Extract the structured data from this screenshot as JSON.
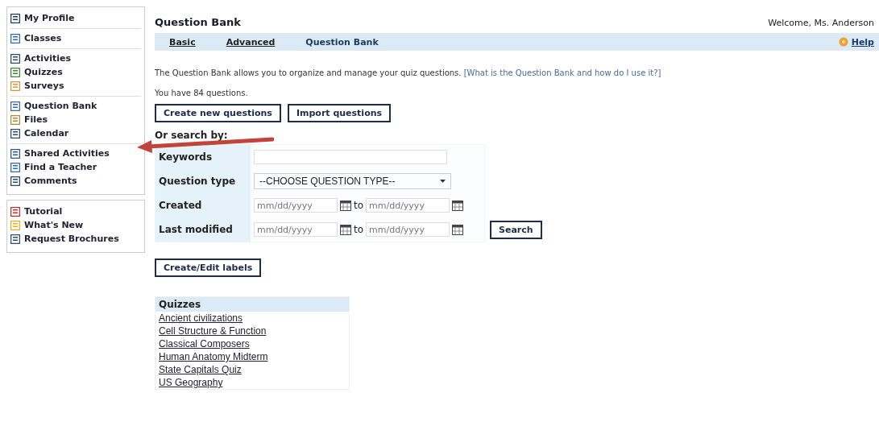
{
  "sidebar": {
    "groups": [
      {
        "sections": [
          {
            "items": [
              {
                "label": "My Profile"
              }
            ]
          },
          {
            "items": [
              {
                "label": "Classes"
              }
            ]
          },
          {
            "items": [
              {
                "label": "Activities"
              },
              {
                "label": "Quizzes"
              },
              {
                "label": "Surveys"
              }
            ]
          },
          {
            "items": [
              {
                "label": "Question Bank"
              },
              {
                "label": "Files"
              },
              {
                "label": "Calendar"
              }
            ]
          },
          {
            "items": [
              {
                "label": "Shared Activities"
              },
              {
                "label": "Find a Teacher"
              },
              {
                "label": "Comments"
              }
            ]
          }
        ]
      },
      {
        "sections": [
          {
            "items": [
              {
                "label": "Tutorial"
              },
              {
                "label": "What's New"
              },
              {
                "label": "Request Brochures"
              }
            ]
          }
        ]
      }
    ]
  },
  "header": {
    "title": "Question Bank",
    "welcome": "Welcome, Ms. Anderson"
  },
  "tabs": [
    {
      "label": "Basic",
      "selected": false
    },
    {
      "label": "Advanced",
      "selected": false
    },
    {
      "label": "Question Bank",
      "selected": true
    }
  ],
  "help": "Help",
  "description": {
    "text": "The Question Bank allows you to organize and manage your quiz questions.",
    "link": "[What is the Question Bank and how do I use it?]"
  },
  "count": "You have 84 questions.",
  "actions": [
    "Create new questions",
    "Import questions"
  ],
  "search": {
    "heading": "Or search by:",
    "keywords_label": "Keywords",
    "type_label": "Question type",
    "type_value": "--CHOOSE QUESTION TYPE--",
    "date_rows": [
      {
        "label": "Created",
        "from_placeholder": "mm/dd/yyyy",
        "to": "to",
        "to_placeholder": "mm/dd/yyyy"
      },
      {
        "label": "Last modified",
        "from_placeholder": "mm/dd/yyyy",
        "to": "to",
        "to_placeholder": "mm/dd/yyyy"
      }
    ],
    "button": "Search"
  },
  "labels_button": "Create/Edit labels",
  "quizzes": {
    "heading": "Quizzes",
    "items": [
      "Ancient civilizations",
      "Cell Structure & Function",
      "Classical Composers",
      "Human Anatomy Midterm",
      "State Capitals Quiz",
      "US Geography"
    ]
  }
}
